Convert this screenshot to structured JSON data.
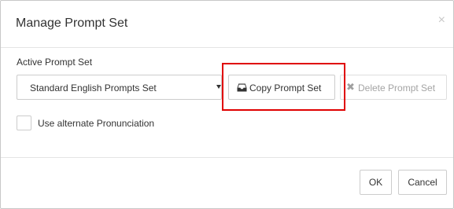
{
  "dialog": {
    "title": "Manage Prompt Set",
    "close_symbol": "×"
  },
  "active_prompt_set": {
    "label": "Active Prompt Set",
    "selected_value": "Standard English Prompts Set"
  },
  "actions": {
    "copy_label": "Copy Prompt Set",
    "copy_icon": "inbox-icon",
    "delete_label": "Delete Prompt Set",
    "delete_icon": "times-icon",
    "delete_symbol": "✖",
    "delete_disabled": true
  },
  "options": {
    "alternate_pronunciation_label": "Use alternate Pronunciation",
    "alternate_pronunciation_checked": false
  },
  "footer": {
    "ok_label": "OK",
    "cancel_label": "Cancel"
  },
  "colors": {
    "highlight": "#e00000",
    "text": "#333333",
    "disabled_text": "#a0a0a0",
    "border": "#cccccc"
  }
}
